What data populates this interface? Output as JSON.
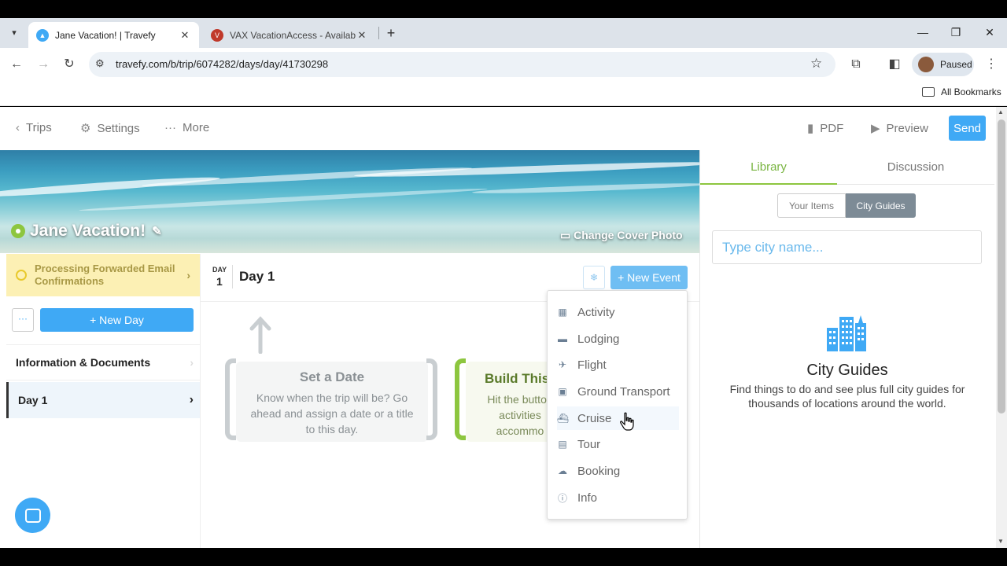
{
  "browser": {
    "tabs": [
      {
        "title": "Jane Vacation! | Travefy",
        "active": true,
        "favicon": "travefy-icon"
      },
      {
        "title": "VAX VacationAccess - Availabili",
        "active": false,
        "favicon": "vax-icon"
      }
    ],
    "url": "travefy.com/b/trip/6074282/days/day/41730298",
    "profile_status": "Paused",
    "bookmarks_label": "All Bookmarks"
  },
  "nav": {
    "trips": "Trips",
    "settings": "Settings",
    "more": "More",
    "pdf": "PDF",
    "preview": "Preview",
    "send": "Send"
  },
  "hero": {
    "title": "Jane Vacation!",
    "change_cover": "Change Cover Photo"
  },
  "sidebar": {
    "processing": "Processing Forwarded Email Confirmations",
    "dots": "···",
    "new_day": "+ New Day",
    "items": [
      {
        "label": "Information & Documents"
      },
      {
        "label": "Day 1"
      }
    ]
  },
  "day": {
    "label": "DAY",
    "number": "1",
    "title": "Day 1",
    "new_event": "+ New Event"
  },
  "cards": {
    "set_date_title": "Set a Date",
    "set_date_body": "Know when the trip will be? Go ahead and assign a date or a title to this day.",
    "build_title": "Build This",
    "build_body_1": "Hit the button",
    "build_body_2": "activities",
    "build_body_3": "accommo"
  },
  "event_menu": [
    {
      "label": "Activity",
      "icon": "calendar-icon"
    },
    {
      "label": "Lodging",
      "icon": "bed-icon"
    },
    {
      "label": "Flight",
      "icon": "plane-icon"
    },
    {
      "label": "Ground Transport",
      "icon": "bus-icon"
    },
    {
      "label": "Cruise",
      "icon": "ship-icon"
    },
    {
      "label": "Tour",
      "icon": "map-icon"
    },
    {
      "label": "Booking",
      "icon": "cloud-icon"
    },
    {
      "label": "Info",
      "icon": "info-icon"
    }
  ],
  "right_panel": {
    "tabs": [
      "Library",
      "Discussion"
    ],
    "segments": [
      "Your Items",
      "City Guides"
    ],
    "search_placeholder": "Type city name...",
    "title": "City Guides",
    "description": "Find things to do and see plus full city guides for thousands of locations around the world."
  },
  "colors": {
    "accent_blue": "#3fa9f5",
    "accent_green": "#8dc63f",
    "processing_bg": "#fcf0b4"
  }
}
